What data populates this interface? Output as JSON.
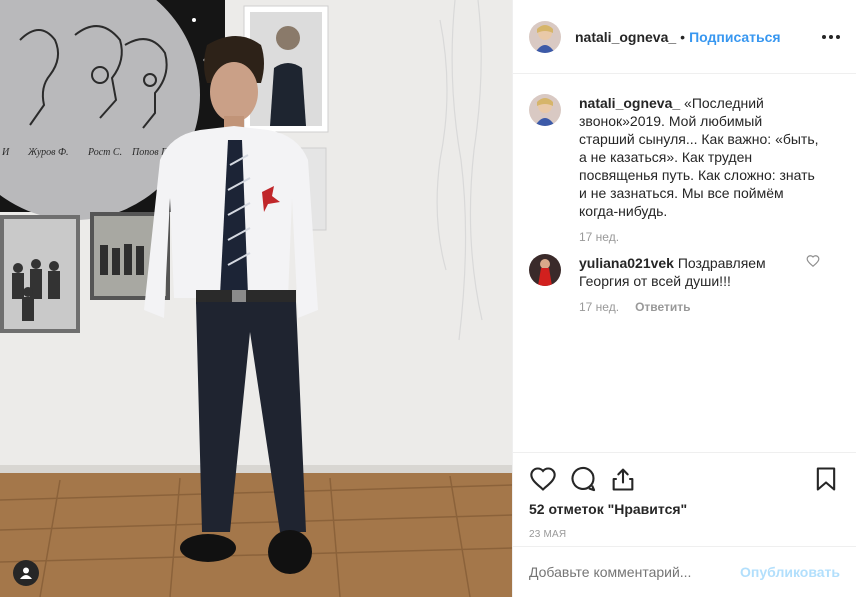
{
  "post": {
    "author": {
      "username": "natali_ogneva_",
      "follow_label": "Подписаться",
      "separator": "•"
    },
    "caption": {
      "username": "natali_ogneva_",
      "text": "«Последний звонок»2019. Мой любимый старший сынуля... Как важно: «быть, а не казаться». Как труден посвященья путь. Как сложно: знать и не зазнаться. Мы все поймём когда-нибудь.",
      "time": "17 нед."
    },
    "comments": [
      {
        "username": "yuliana021vek",
        "text": "Поздравляем Георгия от всей души!!!",
        "time": "17 нед.",
        "reply_label": "Ответить"
      }
    ],
    "likes_text": "52 отметок \"Нравится\"",
    "date": "23 мая",
    "add_comment": {
      "placeholder": "Добавьте комментарий...",
      "publish_label": "Опубликовать"
    },
    "photo": {
      "poster_names": [
        "И",
        "Журов Ф.",
        "Рост С.",
        "Попов Г."
      ]
    }
  },
  "colors": {
    "accent": "#3897f0",
    "publish_disabled": "#b2dffc",
    "muted": "#999999",
    "text": "#262626"
  },
  "icons": [
    "heart-icon",
    "comment-icon",
    "share-icon",
    "bookmark-icon",
    "more-icon",
    "profile-icon"
  ]
}
